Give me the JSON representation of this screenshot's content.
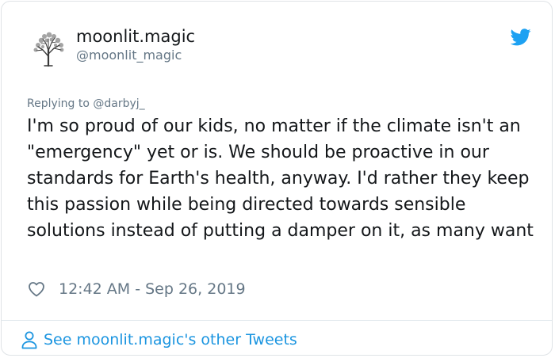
{
  "author": {
    "display_name": "moonlit.magic",
    "handle": "@moonlit_magic",
    "avatar_icon": "tree-avatar-icon"
  },
  "reply": {
    "prefix": "Replying to",
    "to_handle": "@darbyj_"
  },
  "tweet": {
    "text": "I'm so proud of our kids, no matter if the climate isn't an \"emergency\" yet or is. We should be proactive in our standards for Earth's health, anyway. I'd rather they keep this passion while being directed towards sensible solutions instead of putting a damper on it, as many want",
    "timestamp": "12:42 AM - Sep 26, 2019"
  },
  "footer": {
    "link_label": "See moonlit.magic's other Tweets",
    "icon": "person-icon"
  },
  "icons": {
    "brand": "twitter-bird-icon",
    "like": "heart-icon"
  },
  "colors": {
    "brand_blue": "#1da1f2",
    "link_blue": "#1b95e0",
    "text_dark": "#14171a",
    "text_muted": "#657786",
    "border": "#e1e8ed"
  }
}
